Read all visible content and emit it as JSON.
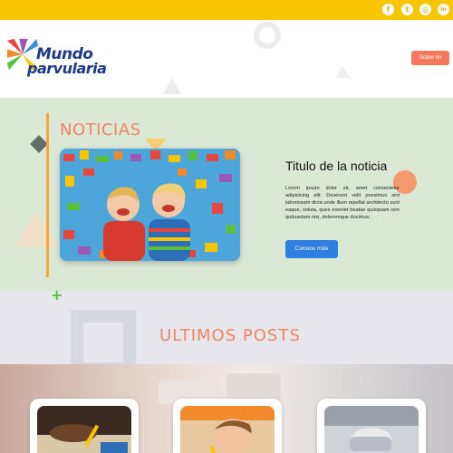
{
  "topbar": {
    "color": "#f7c600",
    "social": [
      {
        "icon": "facebook-icon",
        "glyph": "f"
      },
      {
        "icon": "tumblr-icon",
        "glyph": "t"
      },
      {
        "icon": "instagram-icon",
        "glyph": "◎"
      },
      {
        "icon": "linkedin-icon",
        "glyph": "in"
      }
    ]
  },
  "header": {
    "logo_line1": "Mundo",
    "logo_line2": "parvularia",
    "sobre_label": "Sobre mi",
    "accent": "#f4785c"
  },
  "noticias": {
    "title": "NOTICIAS",
    "headline": "Titulo de la noticia",
    "body": "Lorem ipsum dolor sit, amet consectetur adipisicing elit. Deserunt velit possimus sint laboriosam dicta unde illum repellat architecto sunt eaque, soluta, quos eveniet beatae quisquam rem quibusdam nisi, doloremque ducimus.",
    "button": "Conoce más",
    "background": "#dce8d6",
    "title_color": "#f0845f",
    "button_color": "#2f7fe0"
  },
  "posts": {
    "title": "ULTIMOS POSTS",
    "background": "#e6e6ec"
  }
}
